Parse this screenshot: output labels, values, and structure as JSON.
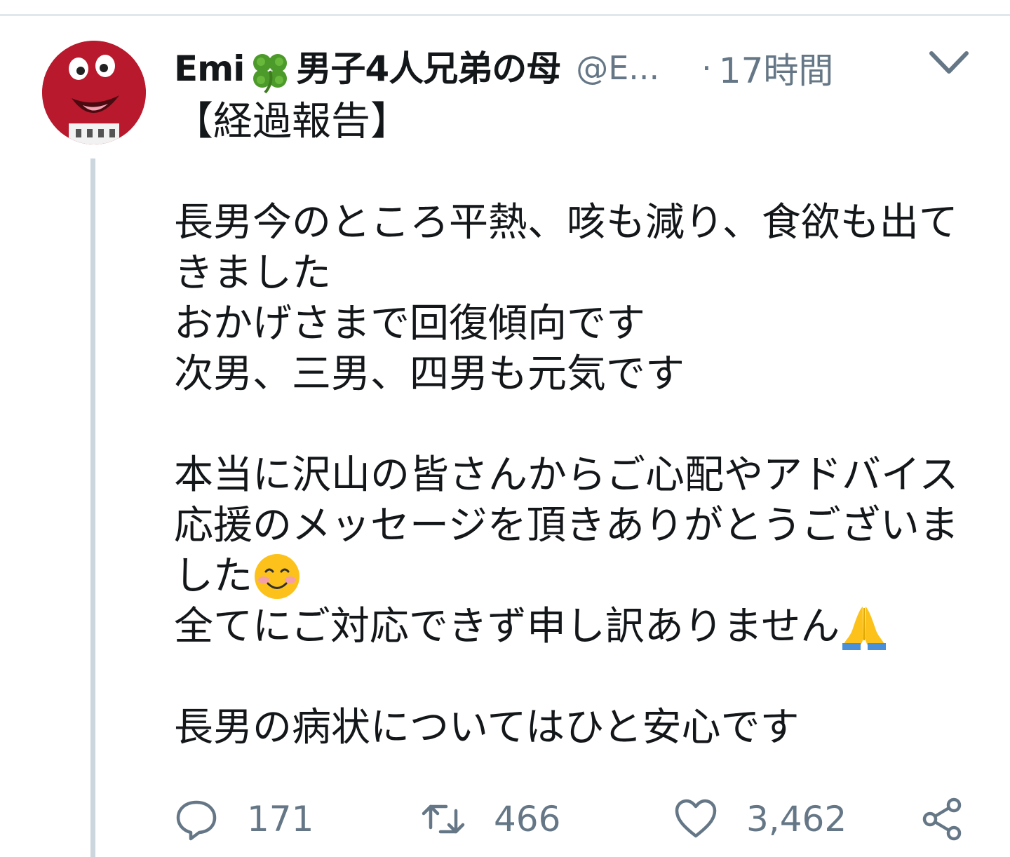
{
  "author": {
    "name_prefix": "Emi",
    "name_suffix": "男子4人兄弟の母",
    "handle": "@E...",
    "separator": "·",
    "time": "17時間"
  },
  "tweet": {
    "lines": [
      "【経過報告】",
      "",
      "",
      "長男今のところ平熱、咳も減り、食欲も出て",
      "きました",
      "おかげさまで回復傾向です",
      "次男、三男、四男も元気です",
      "",
      "",
      "本当に沢山の皆さんからご心配やアドバイス",
      "応援のメッセージを頂きありがとうございま",
      "した",
      "全てにご対応できず申し訳ありません",
      "",
      "",
      "長男の病状についてはひと安心です"
    ]
  },
  "actions": {
    "replies": "171",
    "retweets": "466",
    "likes": "3,462"
  },
  "icons": {
    "name_emoji": "four-leaf-clover",
    "line_11_emoji": "smiling-face-with-blush",
    "line_12_emoji": "folded-hands"
  }
}
